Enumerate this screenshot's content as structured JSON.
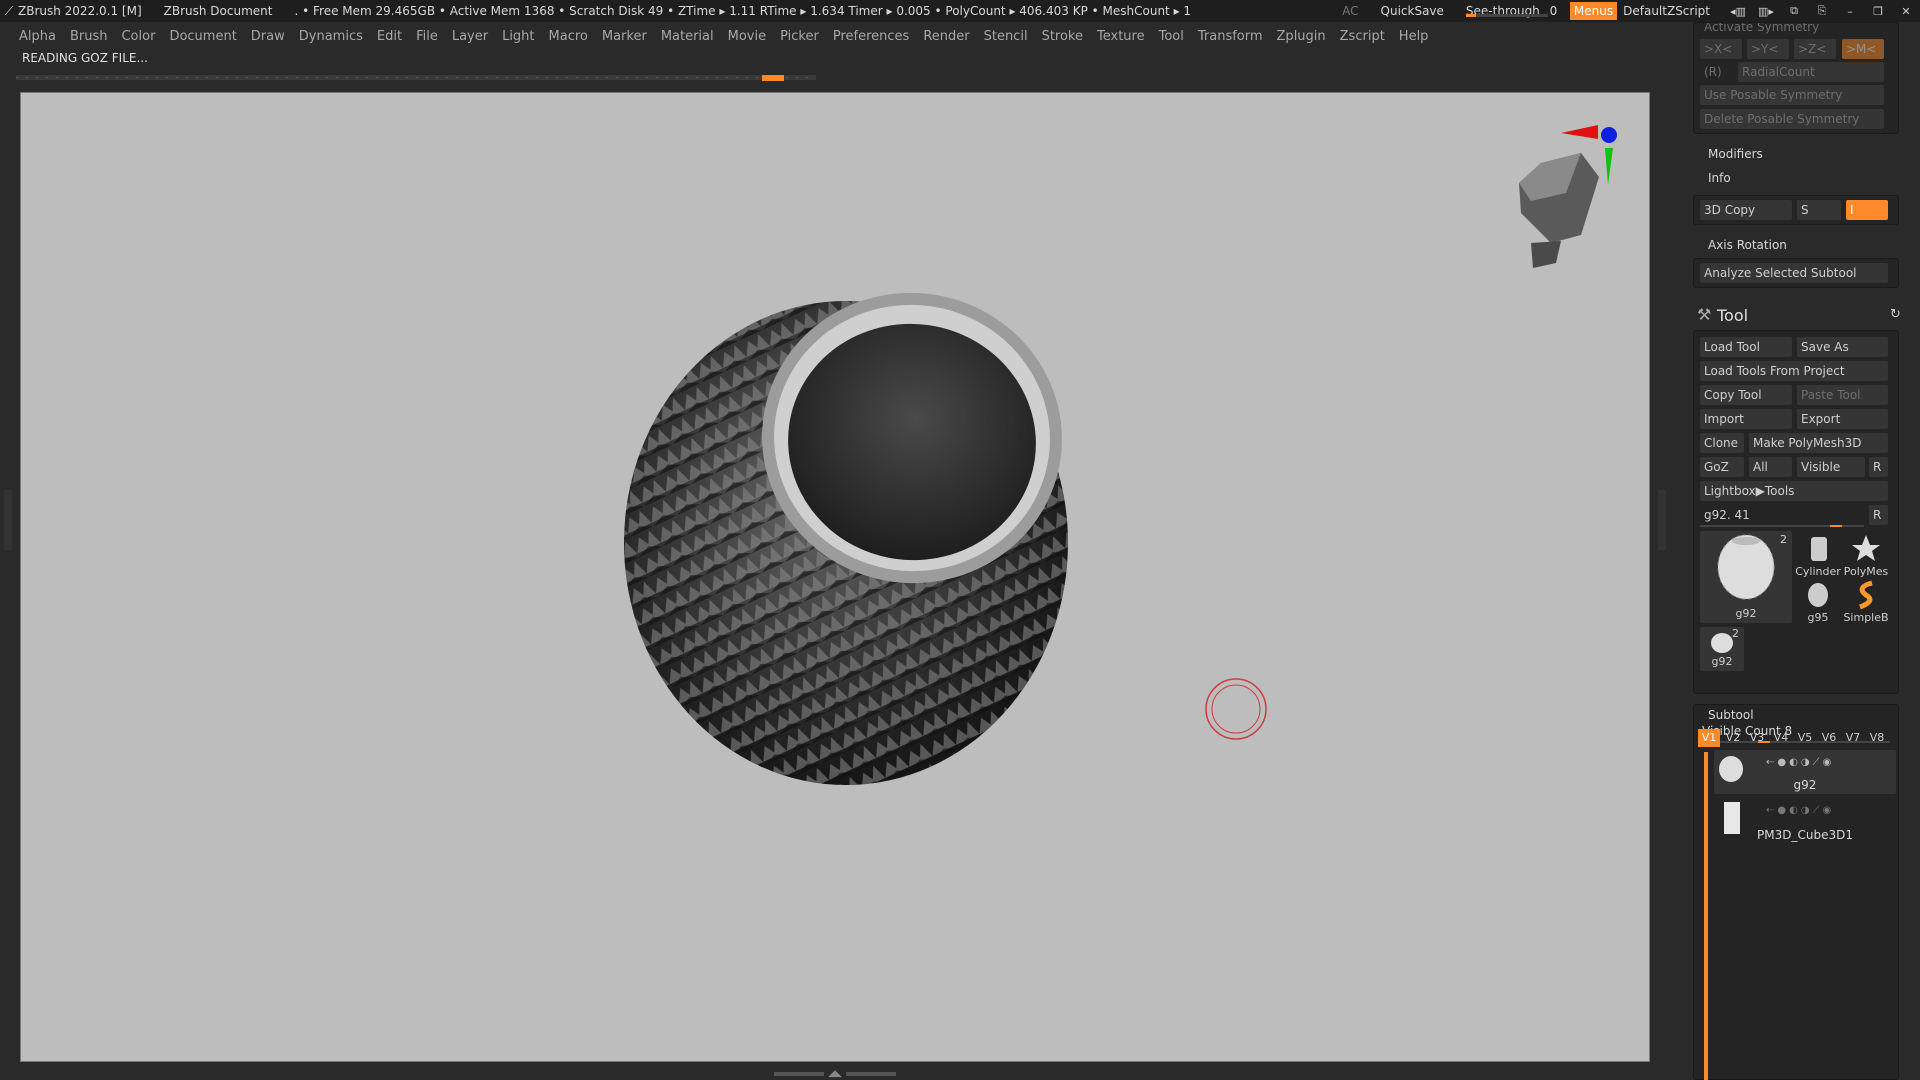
{
  "titlebar": {
    "app": "ZBrush 2022.0.1 [M]",
    "document": "ZBrush Document",
    "stats": ". • Free Mem 29.465GB • Active Mem 1368 • Scratch Disk 49 • ZTime ▸ 1.11 RTime ▸ 1.634 Timer ▸ 0.005 • PolyCount ▸ 406.403 KP • MeshCount ▸ 1",
    "ac": "AC",
    "quicksave": "QuickSave",
    "see_through_label": "See-through",
    "see_through_value": "0",
    "menus": "Menus",
    "zscript": "DefaultZScript"
  },
  "menubar": [
    "Alpha",
    "Brush",
    "Color",
    "Document",
    "Draw",
    "Dynamics",
    "Edit",
    "File",
    "Layer",
    "Light",
    "Macro",
    "Marker",
    "Material",
    "Movie",
    "Picker",
    "Preferences",
    "Render",
    "Stencil",
    "Stroke",
    "Texture",
    "Tool",
    "Transform",
    "Zplugin",
    "Zscript",
    "Help"
  ],
  "status": "READING GOZ FILE...",
  "panel": {
    "symmetry": {
      "header": "Activate Symmetry",
      "x": ">X<",
      "y": ">Y<",
      "z": ">Z<",
      "m": ">M<",
      "r": "(R)",
      "radial": "RadialCount",
      "use_posable": "Use Posable Symmetry",
      "delete_posable": "Delete Posable Symmetry"
    },
    "modifiers": "Modifiers",
    "info": "Info",
    "copy3d": "3D Copy",
    "s": "S",
    "i": "I",
    "axis_rotation": "Axis Rotation",
    "analyze": "Analyze Selected Subtool",
    "tool": {
      "title": "Tool",
      "load_tool": "Load Tool",
      "save_as": "Save As",
      "load_from_project": "Load Tools From Project",
      "copy_tool": "Copy Tool",
      "paste_tool": "Paste Tool",
      "import": "Import",
      "export": "Export",
      "clone": "Clone",
      "make_polymesh": "Make PolyMesh3D",
      "goz": "GoZ",
      "all": "All",
      "visible": "Visible",
      "r": "R",
      "lightbox": "Lightbox▶Tools",
      "current": "g92. 41",
      "current_r": "R",
      "thumbs": {
        "main_label": "g92",
        "main_count": "2",
        "cylinder": "Cylinder",
        "polymesh": "PolyMes",
        "g95": "g95",
        "simpleb": "SimpleB",
        "small_label": "g92",
        "small_count": "2"
      }
    },
    "subtool": {
      "title": "Subtool",
      "visible_count": "Visible Count 8",
      "tabs": [
        "V1",
        "V2",
        "V3",
        "V4",
        "V5",
        "V6",
        "V7",
        "V8"
      ],
      "items": [
        "g92",
        "PM3D_Cube3D1"
      ]
    }
  },
  "colors": {
    "accent": "#ff8a2a",
    "canvas": "#bdbdbd",
    "bg": "#2a2a2a"
  }
}
